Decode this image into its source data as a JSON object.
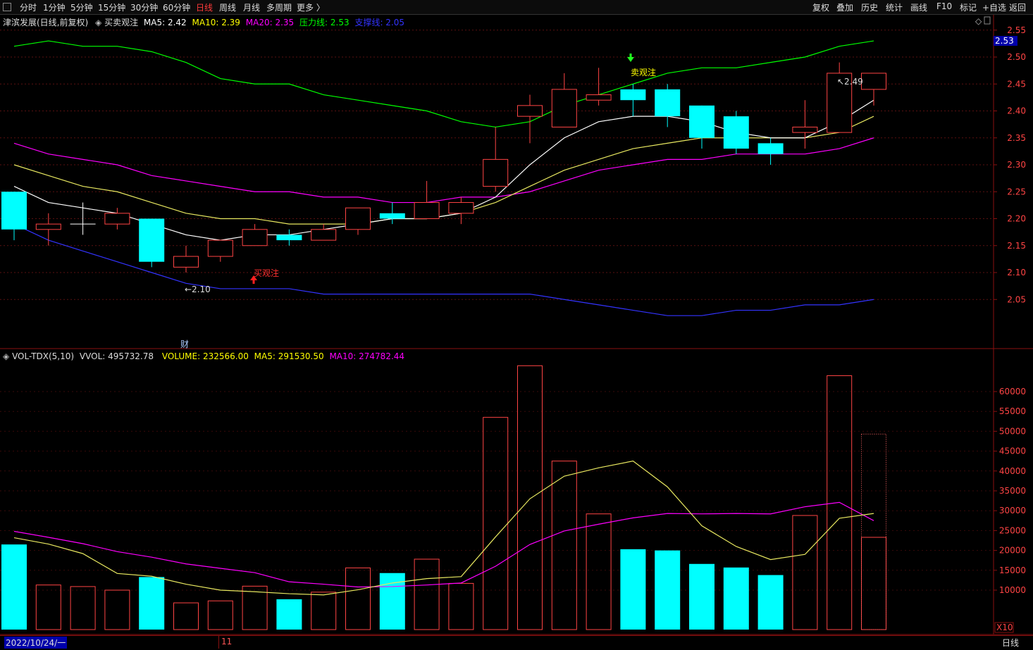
{
  "toolbar": {
    "left": [
      "分时",
      "1分钟",
      "5分钟",
      "15分钟",
      "30分钟",
      "60分钟",
      "日线",
      "周线",
      "月线",
      "多周期",
      "更多 〉"
    ],
    "active": "日线",
    "right": [
      "复权",
      "叠加",
      "历史",
      "统计",
      "画线",
      "F10",
      "标记",
      "+自选",
      "返回"
    ]
  },
  "price_info": {
    "stock": "津滨发展(日线,前复权)",
    "indicator": "买卖观注",
    "ma5": "MA5: 2.42",
    "ma10": "MA10: 2.39",
    "ma20": "MA20: 2.35",
    "resistance": "压力线: 2.53",
    "support": "支撑线: 2.05"
  },
  "volume_info": {
    "name": "VOL-TDX(5,10)",
    "vvol": "VVOL: 495732.78",
    "volume": "VOLUME: 232566.00",
    "ma5": "MA5: 291530.50",
    "ma10": "MA10: 274782.44"
  },
  "annotations": {
    "buy": "买观注",
    "sell": "卖观注",
    "low": "2.10",
    "high": "2.49",
    "cai": "财",
    "vol_unit": "X10",
    "current_price": "2.53"
  },
  "bottom": {
    "date": "2022/10/24/一",
    "month": "11",
    "period": "日线"
  },
  "colors": {
    "up": "#ff4444",
    "down": "#00ffff",
    "ma5": "#ffffff",
    "ma10": "#ffff00",
    "ma20": "#ff00ff",
    "resistance": "#00ff00",
    "support": "#3333ff"
  },
  "chart_data": [
    {
      "type": "candlestick",
      "title": "津滨发展(日线,前复权)",
      "ylim": [
        2.0,
        2.55
      ],
      "y_ticks": [
        2.05,
        2.1,
        2.15,
        2.2,
        2.25,
        2.3,
        2.35,
        2.4,
        2.45,
        2.5,
        2.55
      ],
      "candles": [
        {
          "o": 2.25,
          "h": 2.25,
          "l": 2.16,
          "c": 2.18,
          "dir": "down"
        },
        {
          "o": 2.18,
          "h": 2.21,
          "l": 2.15,
          "c": 2.19,
          "dir": "up"
        },
        {
          "o": 2.19,
          "h": 2.23,
          "l": 2.17,
          "c": 2.19,
          "dir": "doji"
        },
        {
          "o": 2.19,
          "h": 2.22,
          "l": 2.18,
          "c": 2.21,
          "dir": "up"
        },
        {
          "o": 2.2,
          "h": 2.2,
          "l": 2.11,
          "c": 2.12,
          "dir": "down"
        },
        {
          "o": 2.11,
          "h": 2.15,
          "l": 2.1,
          "c": 2.13,
          "dir": "up"
        },
        {
          "o": 2.13,
          "h": 2.16,
          "l": 2.12,
          "c": 2.16,
          "dir": "up"
        },
        {
          "o": 2.15,
          "h": 2.19,
          "l": 2.15,
          "c": 2.18,
          "dir": "up"
        },
        {
          "o": 2.17,
          "h": 2.18,
          "l": 2.15,
          "c": 2.16,
          "dir": "down"
        },
        {
          "o": 2.16,
          "h": 2.19,
          "l": 2.16,
          "c": 2.18,
          "dir": "up"
        },
        {
          "o": 2.18,
          "h": 2.22,
          "l": 2.17,
          "c": 2.22,
          "dir": "up"
        },
        {
          "o": 2.21,
          "h": 2.23,
          "l": 2.19,
          "c": 2.2,
          "dir": "down"
        },
        {
          "o": 2.2,
          "h": 2.27,
          "l": 2.2,
          "c": 2.23,
          "dir": "up"
        },
        {
          "o": 2.21,
          "h": 2.24,
          "l": 2.19,
          "c": 2.23,
          "dir": "up"
        },
        {
          "o": 2.26,
          "h": 2.37,
          "l": 2.25,
          "c": 2.31,
          "dir": "up"
        },
        {
          "o": 2.39,
          "h": 2.43,
          "l": 2.34,
          "c": 2.41,
          "dir": "up"
        },
        {
          "o": 2.37,
          "h": 2.47,
          "l": 2.37,
          "c": 2.44,
          "dir": "up"
        },
        {
          "o": 2.42,
          "h": 2.48,
          "l": 2.41,
          "c": 2.43,
          "dir": "up"
        },
        {
          "o": 2.44,
          "h": 2.45,
          "l": 2.39,
          "c": 2.42,
          "dir": "down"
        },
        {
          "o": 2.44,
          "h": 2.45,
          "l": 2.37,
          "c": 2.39,
          "dir": "down"
        },
        {
          "o": 2.41,
          "h": 2.41,
          "l": 2.33,
          "c": 2.35,
          "dir": "down"
        },
        {
          "o": 2.39,
          "h": 2.4,
          "l": 2.32,
          "c": 2.33,
          "dir": "down"
        },
        {
          "o": 2.34,
          "h": 2.35,
          "l": 2.3,
          "c": 2.32,
          "dir": "down"
        },
        {
          "o": 2.36,
          "h": 2.42,
          "l": 2.33,
          "c": 2.37,
          "dir": "up"
        },
        {
          "o": 2.36,
          "h": 2.49,
          "l": 2.36,
          "c": 2.47,
          "dir": "up"
        },
        {
          "o": 2.44,
          "h": 2.47,
          "l": 2.41,
          "c": 2.47,
          "dir": "up"
        }
      ],
      "ma5": [
        2.26,
        2.23,
        2.22,
        2.21,
        2.19,
        2.17,
        2.16,
        2.17,
        2.17,
        2.18,
        2.19,
        2.2,
        2.2,
        2.21,
        2.24,
        2.3,
        2.35,
        2.38,
        2.39,
        2.39,
        2.38,
        2.36,
        2.35,
        2.35,
        2.38,
        2.42
      ],
      "ma10": [
        2.3,
        2.28,
        2.26,
        2.25,
        2.23,
        2.21,
        2.2,
        2.2,
        2.19,
        2.19,
        2.19,
        2.2,
        2.2,
        2.21,
        2.23,
        2.26,
        2.29,
        2.31,
        2.33,
        2.34,
        2.35,
        2.35,
        2.35,
        2.35,
        2.36,
        2.39
      ],
      "ma20": [
        2.34,
        2.32,
        2.31,
        2.3,
        2.28,
        2.27,
        2.26,
        2.25,
        2.25,
        2.24,
        2.24,
        2.23,
        2.23,
        2.24,
        2.24,
        2.25,
        2.27,
        2.29,
        2.3,
        2.31,
        2.31,
        2.32,
        2.32,
        2.32,
        2.33,
        2.35
      ],
      "resistance": [
        2.52,
        2.53,
        2.52,
        2.52,
        2.51,
        2.49,
        2.46,
        2.45,
        2.45,
        2.43,
        2.42,
        2.41,
        2.4,
        2.38,
        2.37,
        2.38,
        2.41,
        2.43,
        2.45,
        2.47,
        2.48,
        2.48,
        2.49,
        2.5,
        2.52,
        2.53
      ],
      "support": [
        2.19,
        2.16,
        2.14,
        2.12,
        2.1,
        2.08,
        2.07,
        2.07,
        2.07,
        2.06,
        2.06,
        2.06,
        2.06,
        2.06,
        2.06,
        2.06,
        2.05,
        2.04,
        2.03,
        2.02,
        2.02,
        2.03,
        2.03,
        2.04,
        2.04,
        2.05
      ]
    },
    {
      "type": "bar",
      "title": "VOL-TDX(5,10)",
      "ylim": [
        0,
        67000
      ],
      "y_ticks": [
        10000,
        15000,
        20000,
        25000,
        30000,
        35000,
        40000,
        45000,
        50000,
        55000,
        60000
      ],
      "values": [
        21500,
        11300,
        10900,
        10000,
        13300,
        6800,
        7300,
        11000,
        7700,
        9500,
        15600,
        14300,
        17800,
        11700,
        53500,
        66500,
        42500,
        29200,
        20300,
        20000,
        16600,
        15700,
        13800,
        28800,
        64000,
        23300
      ],
      "dirs": [
        "down",
        "up",
        "up",
        "up",
        "down",
        "up",
        "up",
        "up",
        "down",
        "up",
        "up",
        "down",
        "up",
        "up",
        "up",
        "up",
        "up",
        "up",
        "down",
        "down",
        "down",
        "down",
        "down",
        "up",
        "up",
        "up"
      ],
      "ma5": [
        23200,
        21600,
        19200,
        14200,
        13500,
        11500,
        10000,
        9600,
        9100,
        8800,
        10100,
        11800,
        12900,
        13400,
        23400,
        33000,
        38700,
        40800,
        42500,
        36000,
        26200,
        21000,
        17700,
        19000,
        28100,
        29300
      ],
      "ma10": [
        24800,
        23300,
        21700,
        19700,
        18300,
        16600,
        15500,
        14400,
        12100,
        11500,
        10800,
        10900,
        11300,
        11800,
        16000,
        21500,
        24900,
        26600,
        28200,
        29300,
        29200,
        29300,
        29200,
        31000,
        32100,
        27500
      ],
      "ghost_bar": 49300
    }
  ]
}
